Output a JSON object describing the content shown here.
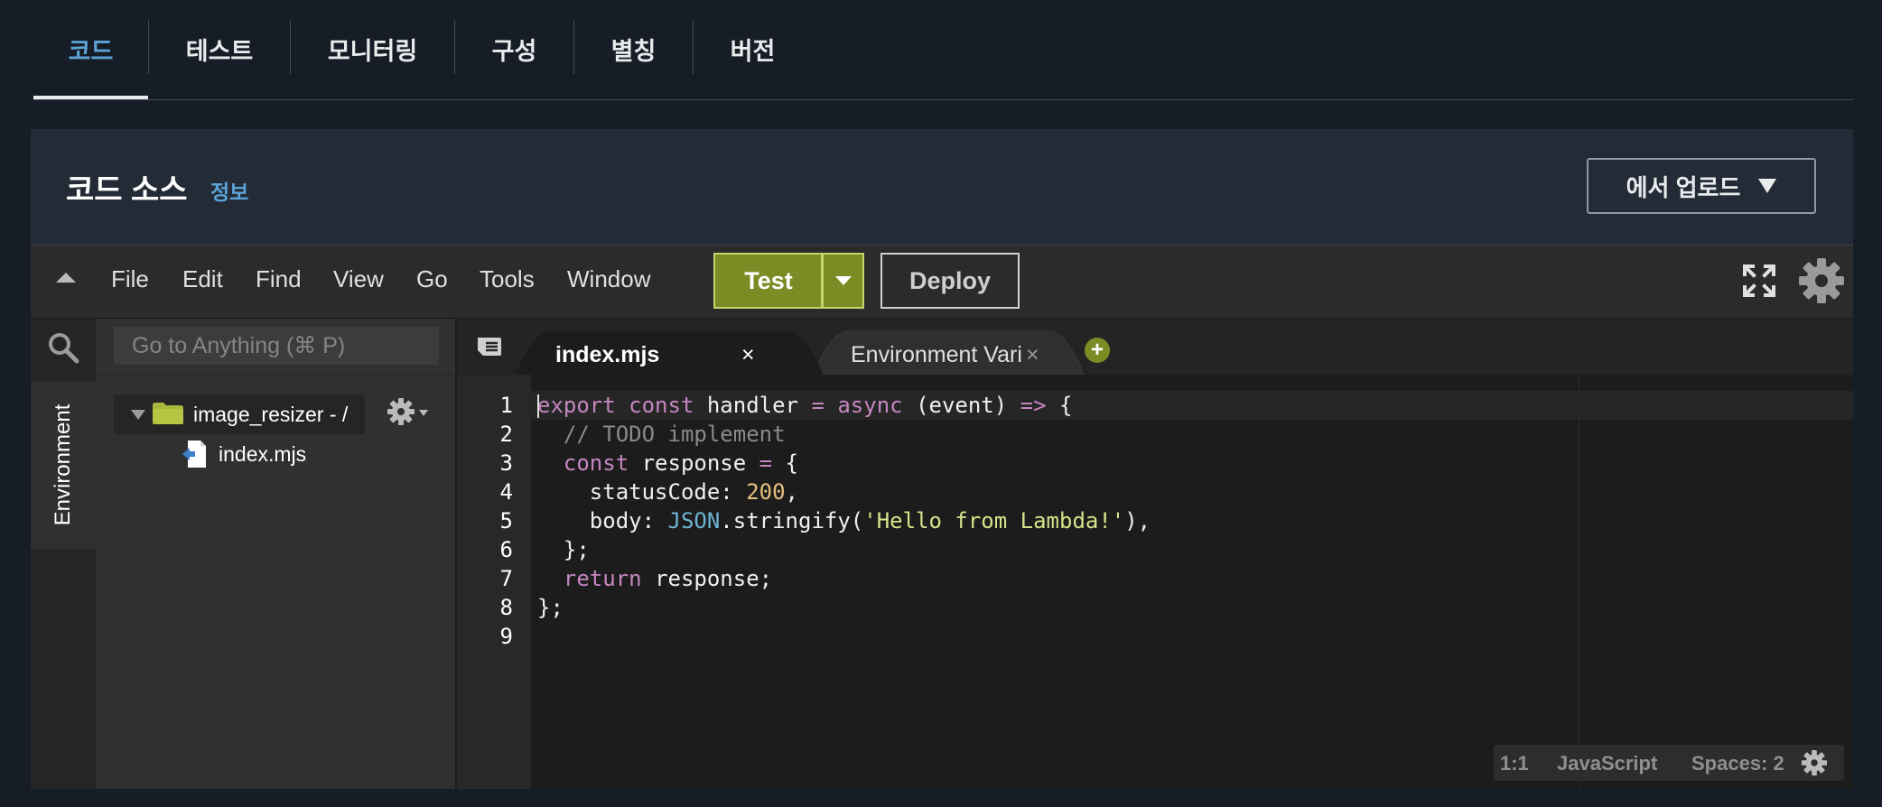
{
  "top_tabs": [
    {
      "label": "코드"
    },
    {
      "label": "테스트"
    },
    {
      "label": "모니터링"
    },
    {
      "label": "구성"
    },
    {
      "label": "별칭"
    },
    {
      "label": "버전"
    }
  ],
  "panel": {
    "title": "코드 소스",
    "info_link": "정보",
    "upload_button": "에서 업로드"
  },
  "toolbar": {
    "menu": [
      "File",
      "Edit",
      "Find",
      "View",
      "Go",
      "Tools",
      "Window"
    ],
    "test_label": "Test",
    "deploy_label": "Deploy"
  },
  "sidebar": {
    "environment_tab": "Environment",
    "goto_placeholder": "Go to Anything (⌘ P)",
    "folder": "image_resizer - /",
    "file": "index.mjs"
  },
  "editor": {
    "tabs": [
      {
        "label": "index.mjs",
        "active": true
      },
      {
        "label": "Environment Vari",
        "active": false
      }
    ],
    "close_glyph": "×",
    "add_tab_glyph": "+",
    "lines": [
      [
        [
          "k",
          "export "
        ],
        [
          "k",
          "const "
        ],
        [
          "",
          "handler "
        ],
        [
          "o",
          "= "
        ],
        [
          "k",
          "async "
        ],
        [
          "",
          "(event) "
        ],
        [
          "o",
          "=> "
        ],
        [
          "",
          "{"
        ]
      ],
      [
        [
          "c",
          "  // TODO implement"
        ]
      ],
      [
        [
          "",
          "  "
        ],
        [
          "k",
          "const "
        ],
        [
          "",
          "response "
        ],
        [
          "o",
          "= "
        ],
        [
          "",
          "{"
        ]
      ],
      [
        [
          "",
          "    statusCode: "
        ],
        [
          "n",
          "200"
        ],
        [
          "",
          ","
        ]
      ],
      [
        [
          "",
          "    body: "
        ],
        [
          "b",
          "JSON"
        ],
        [
          "",
          ".stringify("
        ],
        [
          "s",
          "'Hello from Lambda!'"
        ],
        [
          "",
          "),"
        ]
      ],
      [
        [
          "",
          "  };"
        ]
      ],
      [
        [
          "",
          "  "
        ],
        [
          "k",
          "return "
        ],
        [
          "",
          "response;"
        ]
      ],
      [
        [
          "",
          "};"
        ]
      ],
      [
        [
          "",
          ""
        ]
      ]
    ],
    "line_numbers": [
      "1",
      "2",
      "3",
      "4",
      "5",
      "6",
      "7",
      "8",
      "9"
    ]
  },
  "status": {
    "position": "1:1",
    "language": "JavaScript",
    "indent": "Spaces: 2"
  },
  "colors": {
    "accent_blue": "#5ca4d8",
    "test_green": "#7c8c25",
    "keyword": "#c586c0",
    "number": "#e5c07b",
    "string": "#d7e28a"
  }
}
